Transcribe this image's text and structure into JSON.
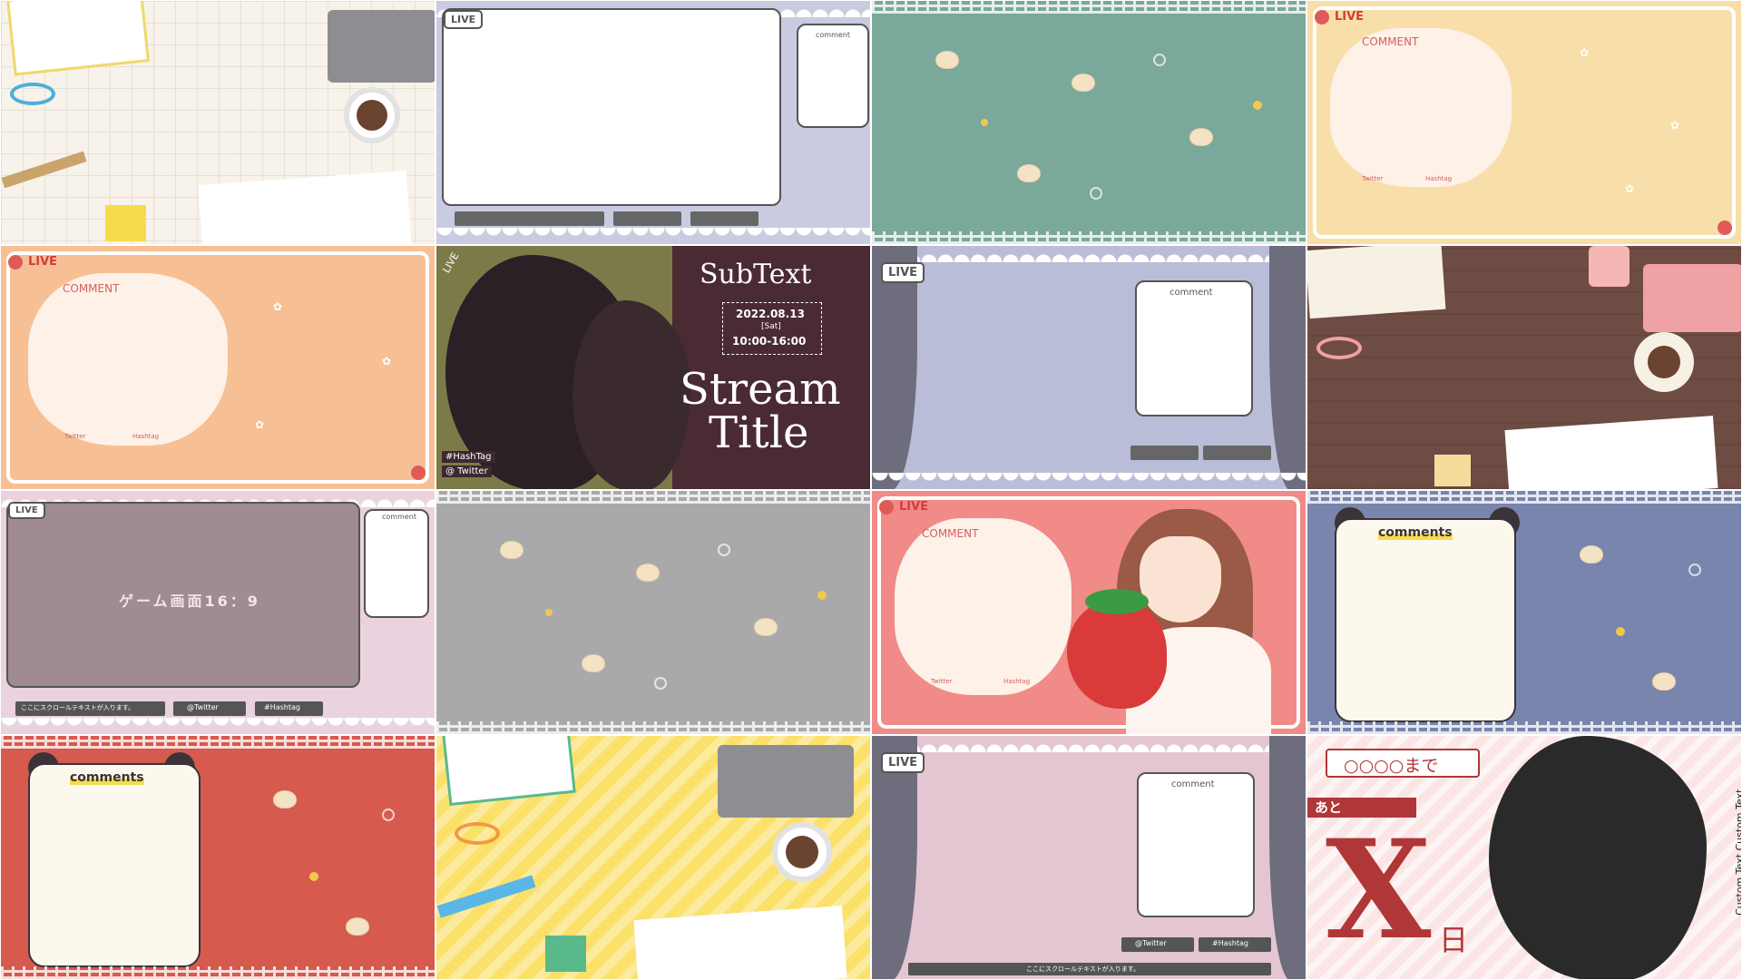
{
  "tiles": {
    "t1": {
      "colors": {
        "bg": "#f7f2ea",
        "grid": "#e8e0d6"
      }
    },
    "t2": {
      "live": "LIVE",
      "comment": "comment",
      "colors": {
        "bg": "#c9cbe0"
      }
    },
    "t3": {
      "colors": {
        "bg": "#7aa89a"
      }
    },
    "t4": {
      "live": "LIVE",
      "comment": "COMMENT",
      "twitter": "Twitter",
      "hashtag": "Hashtag",
      "colors": {
        "bg": "#f8dea8",
        "cloud": "#fdf0e6"
      }
    },
    "t5": {
      "live": "LIVE",
      "comment": "COMMENT",
      "twitter": "Twitter",
      "hashtag": "Hashtag",
      "colors": {
        "bg": "#f7c094",
        "cloud": "#fdf1e8"
      }
    },
    "t6": {
      "live": "LIVE",
      "subtext": "SubText",
      "date": "2022.08.13",
      "day": "[Sat]",
      "time": "10:00-16:00",
      "title1": "Stream",
      "title2": "Title",
      "hashtag": "#HashTag",
      "twitter": "@ Twitter",
      "colors": {
        "bg": "#4a2a33",
        "left": "#7d7a4a"
      }
    },
    "t7": {
      "live": "LIVE",
      "comment": "comment",
      "colors": {
        "bg": "#b9bdd8",
        "curtain": "#6d6d7d"
      }
    },
    "t8": {
      "colors": {
        "bg": "#6e4c44"
      }
    },
    "t9": {
      "live": "LIVE",
      "comment": "comment",
      "game": "ゲーム画面16：9",
      "scroll": "ここにスクロールテキストが入ります。",
      "twitter": "@Twitter",
      "hashtag": "#Hashtag",
      "colors": {
        "bg": "#ead2de",
        "screen": "#a08b93"
      }
    },
    "t10": {
      "colors": {
        "bg": "#a9a9ab"
      }
    },
    "t11": {
      "live": "LIVE",
      "comment": "COMMENT",
      "twitter": "Twitter",
      "hashtag": "Hashtag",
      "colors": {
        "bg": "#f08b87",
        "cloud": "#fdf1e8"
      }
    },
    "t12": {
      "comments": "comments",
      "colors": {
        "bg": "#7985ad"
      }
    },
    "t13": {
      "comments": "comments",
      "colors": {
        "bg": "#d65a4e"
      }
    },
    "t14": {
      "colors": {
        "bg": "#fbe06a"
      }
    },
    "t15": {
      "live": "LIVE",
      "comment": "comment",
      "twitter": "@Twitter",
      "hashtag": "#Hashtag",
      "scroll": "ここにスクロールテキストが入ります。",
      "colors": {
        "bg": "#e3c6d2",
        "curtain": "#6d6d7d"
      }
    },
    "t16": {
      "countdown": "○○○○まで",
      "remaining": "あと",
      "bigx": "X",
      "day": "日",
      "vertical": "Custom Text Custom Text.",
      "colors": {
        "bg": "#fbe5e5",
        "red": "#b03737"
      }
    }
  }
}
